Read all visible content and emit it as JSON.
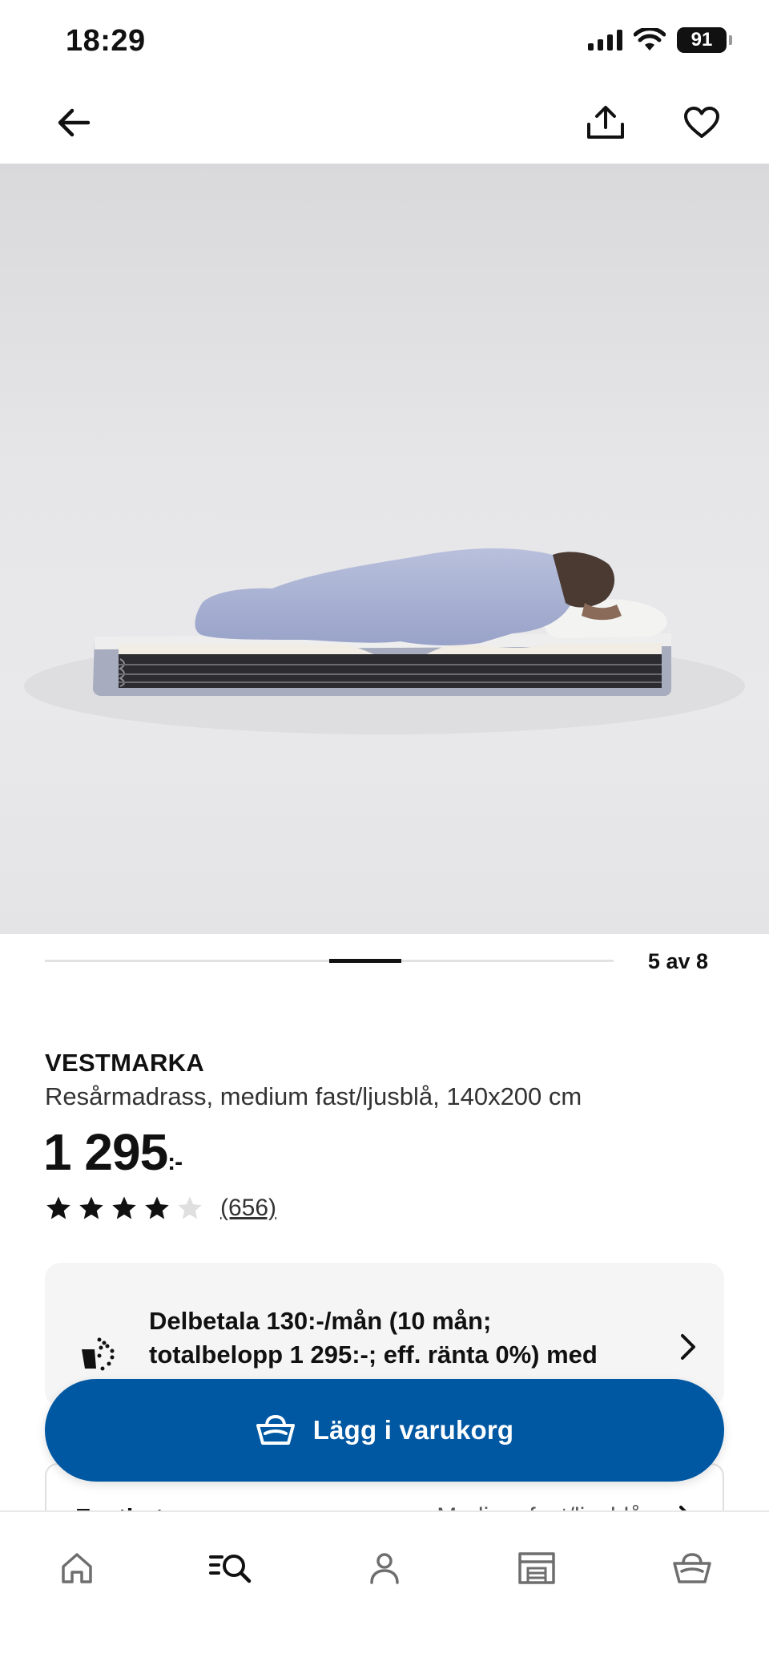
{
  "status_bar": {
    "time": "18:29",
    "battery": "91"
  },
  "carousel": {
    "counter": "5 av 8"
  },
  "product": {
    "name": "VESTMARKA",
    "description": "Resårmadrass, medium fast/ljusblå, 140x200 cm",
    "price": "1 295",
    "price_suffix": ":-",
    "rating": 4,
    "rating_max": 5,
    "review_count": "(656)"
  },
  "financing": {
    "text": "Delbetala 130:-/mån (10 mån; totalbelopp 1 295:-; eff. ränta 0%) med Ikano Bank"
  },
  "add_to_cart": {
    "label": "Lägg i varukorg"
  },
  "firmness_card": {
    "title": "Fasthet",
    "value": "Medium fast/ljusblå"
  },
  "tab_bar": {
    "items": [
      "home-icon",
      "search-menu-icon",
      "profile-icon",
      "store-icon",
      "cart-icon"
    ],
    "active": "search-menu-icon"
  },
  "colors": {
    "accent_blue": "#0058a3",
    "card_bg": "#f5f5f5"
  }
}
